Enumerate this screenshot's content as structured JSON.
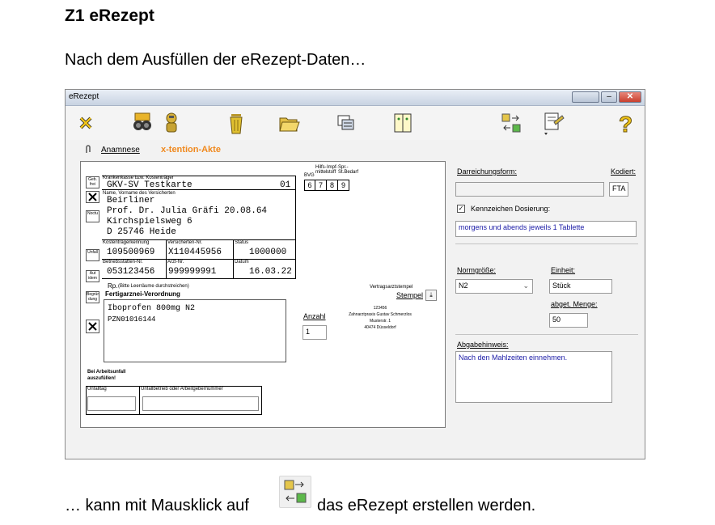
{
  "doc": {
    "title": "Z1 eRezept",
    "intro": "Nach dem Ausfüllen der eRezept-Daten…",
    "outro_part1": "… kann mit Mausklick auf",
    "outro_part2": "das eRezept erstellen werden."
  },
  "window": {
    "title": "eRezept",
    "controls": [
      "minimize-button",
      "maximize-button",
      "close-button"
    ]
  },
  "toolbar": {
    "icons": [
      "cancel-icon",
      "search-binoculars-icon",
      "connect-icon",
      "delete-icon",
      "open-folder-icon",
      "copy-icon",
      "form-icon",
      "create-erezept-icon",
      "print-icon",
      "help-icon"
    ]
  },
  "tabs": {
    "anamnese": "Anamnese",
    "xtention": "x-tention-Akte"
  },
  "form": {
    "krankenkasse_label": "Krankenkasse bzw. Kostenträger",
    "krankenkasse_value": "GKV-SV Testkarte",
    "kk_code": "01",
    "bvg_label": "BVG",
    "hilfsmittel_label": "Hilfs-mittel",
    "impfstoff_label": "Impf-stoff",
    "sprstbedarf_label": "Spr.-St.Bedarf",
    "cells": [
      "6",
      "7",
      "8",
      "9"
    ],
    "name_label": "Name, Vorname des Versicherten",
    "patient_lines": [
      "Beirliner",
      "Prof. Dr. Julia Gräfi 20.08.64",
      "Kirchspielsweg 6",
      "D 25746 Heide"
    ],
    "kostentraeger_label": "Kostenträgerkennung",
    "kostentraeger_value": "109500969",
    "versichertennr_label": "Versicherten-Nr.",
    "versichertennr_value": "X110445956",
    "status_label": "Status",
    "status_value": "1000000",
    "betriebsstaette_label": "Betriebsstätten-Nr.",
    "betriebsstaette_value": "053123456",
    "arzt_label": "Arzt-Nr.",
    "arzt_value": "999999991",
    "datum_label": "Datum",
    "datum_value": "16.03.22",
    "rp_label": "Rp.",
    "rp_hint": "(Bitte Leerräume durchstreichen)",
    "fertig_label": "Fertigarznei-Verordnung",
    "med_line1": "Iboprofen 800mg N2",
    "med_line2": "PZN01016144",
    "anzahl_label": "Anzahl",
    "anzahl_value": "1",
    "stempel_top": "Vertragsarztstempel",
    "stempel_label": "Stempel",
    "stempel_lines": [
      "123456",
      "Zahnarztpraxis Gustav Schmerzlos",
      "Musterstr. 1",
      "40474 Düsseldorf"
    ],
    "side_buttons": [
      "Geb. frei",
      "Noctu",
      "Unfall",
      "Aut idem",
      "Begrün-dung"
    ],
    "arbeitsunfall_label": "Bei Arbeitsunfall auszufüllen!",
    "unfalltag_label": "Unfalltag",
    "unfallbetrieb_label": "Unfallbetrieb oder Arbeitgebernummer"
  },
  "panel": {
    "darreichung_label": "Darreichungsform:",
    "kodiert_label": "Kodiert:",
    "darreichung_value": "",
    "kodiert_value": "FTA",
    "dosierung_checkbox_label": "Kennzeichen Dosierung:",
    "dosierung_checked": true,
    "dosierung_value": "morgens und abends jeweils 1 Tablette",
    "normgroesse_label": "Normgröße:",
    "normgroesse_value": "N2",
    "einheit_label": "Einheit:",
    "einheit_value": "Stück",
    "abgetmenge_label": "abget. Menge:",
    "abgetmenge_value": "50",
    "abgabehinweis_label": "Abgabehinweis:",
    "abgabehinweis_value": "Nach den Mahlzeiten einnehmen."
  }
}
